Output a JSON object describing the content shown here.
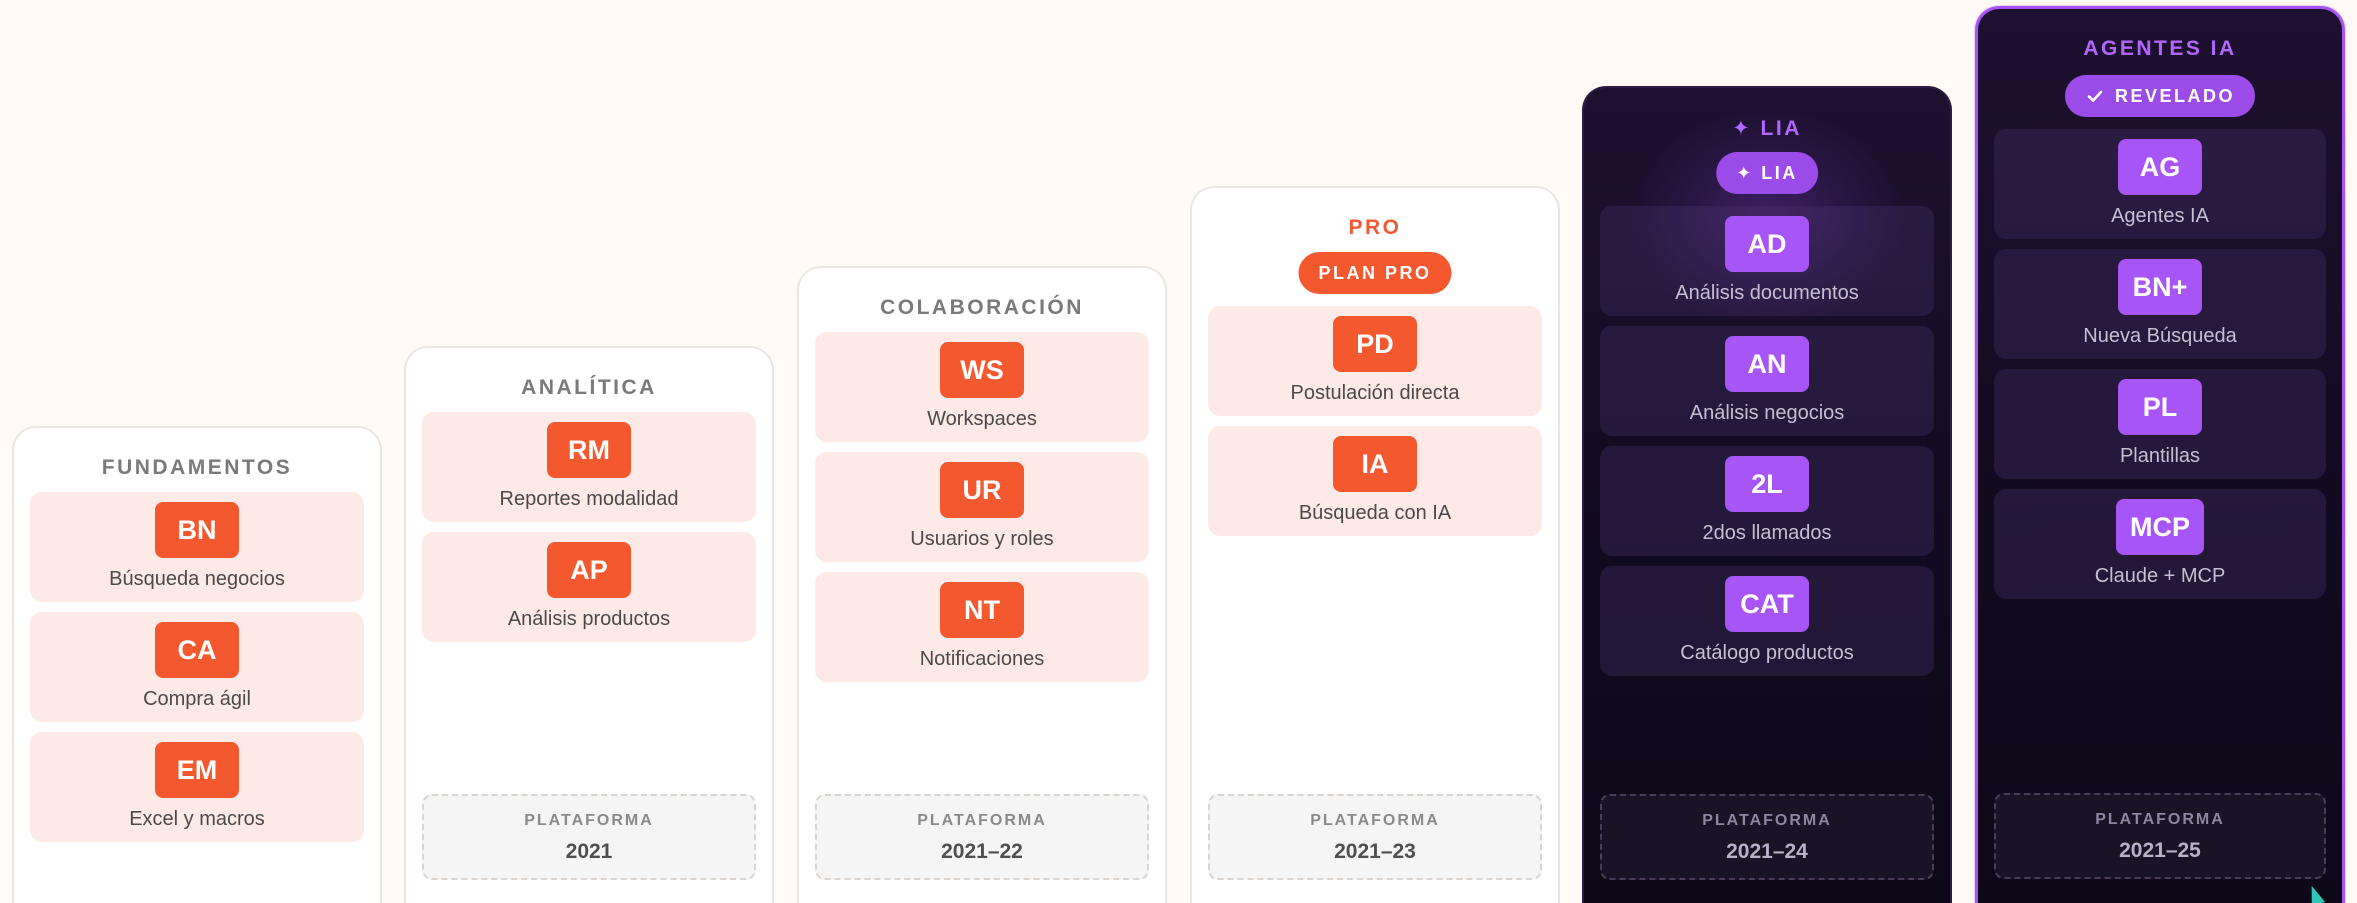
{
  "columns": [
    {
      "title": "FUNDAMENTOS",
      "badge": null,
      "cards": [
        {
          "code": "BN",
          "label": "Búsqueda negocios"
        },
        {
          "code": "CA",
          "label": "Compra ágil"
        },
        {
          "code": "EM",
          "label": "Excel y macros"
        }
      ],
      "platform": null
    },
    {
      "title": "ANALÍTICA",
      "badge": null,
      "cards": [
        {
          "code": "RM",
          "label": "Reportes modalidad"
        },
        {
          "code": "AP",
          "label": "Análisis productos"
        }
      ],
      "platform": {
        "label": "PLATAFORMA",
        "value": "2021"
      }
    },
    {
      "title": "COLABORACIÓN",
      "badge": null,
      "cards": [
        {
          "code": "WS",
          "label": "Workspaces"
        },
        {
          "code": "UR",
          "label": "Usuarios y roles"
        },
        {
          "code": "NT",
          "label": "Notificaciones"
        }
      ],
      "platform": {
        "label": "PLATAFORMA",
        "value": "2021–22"
      }
    },
    {
      "title": "PRO",
      "badge": {
        "label": "PLAN PRO"
      },
      "cards": [
        {
          "code": "PD",
          "label": "Postulación directa"
        },
        {
          "code": "IA",
          "label": "Búsqueda con IA"
        }
      ],
      "platform": {
        "label": "PLATAFORMA",
        "value": "2021–23"
      }
    },
    {
      "title": "✦ LIA",
      "badge": {
        "label": "✦ LIA"
      },
      "cards": [
        {
          "code": "AD",
          "label": "Análisis documentos"
        },
        {
          "code": "AN",
          "label": "Análisis negocios"
        },
        {
          "code": "2L",
          "label": "2dos llamados"
        },
        {
          "code": "CAT",
          "label": "Catálogo productos"
        }
      ],
      "platform": {
        "label": "PLATAFORMA",
        "value": "2021–24"
      }
    },
    {
      "title": "AGENTES IA",
      "badge": {
        "label": "REVELADO",
        "icon": "check-icon"
      },
      "cards": [
        {
          "code": "AG",
          "label": "Agentes IA"
        },
        {
          "code": "BN+",
          "label": "Nueva Búsqueda"
        },
        {
          "code": "PL",
          "label": "Plantillas"
        },
        {
          "code": "MCP",
          "label": "Claude + MCP"
        }
      ],
      "platform": {
        "label": "PLATAFORMA",
        "value": "2021–25"
      }
    }
  ],
  "colors": {
    "orange_accent": "#f4582f",
    "purple_accent": "#a855f7",
    "card_light": "#fdeae6",
    "dark_bg": "#140b22",
    "page_bg": "#fffaf6"
  }
}
